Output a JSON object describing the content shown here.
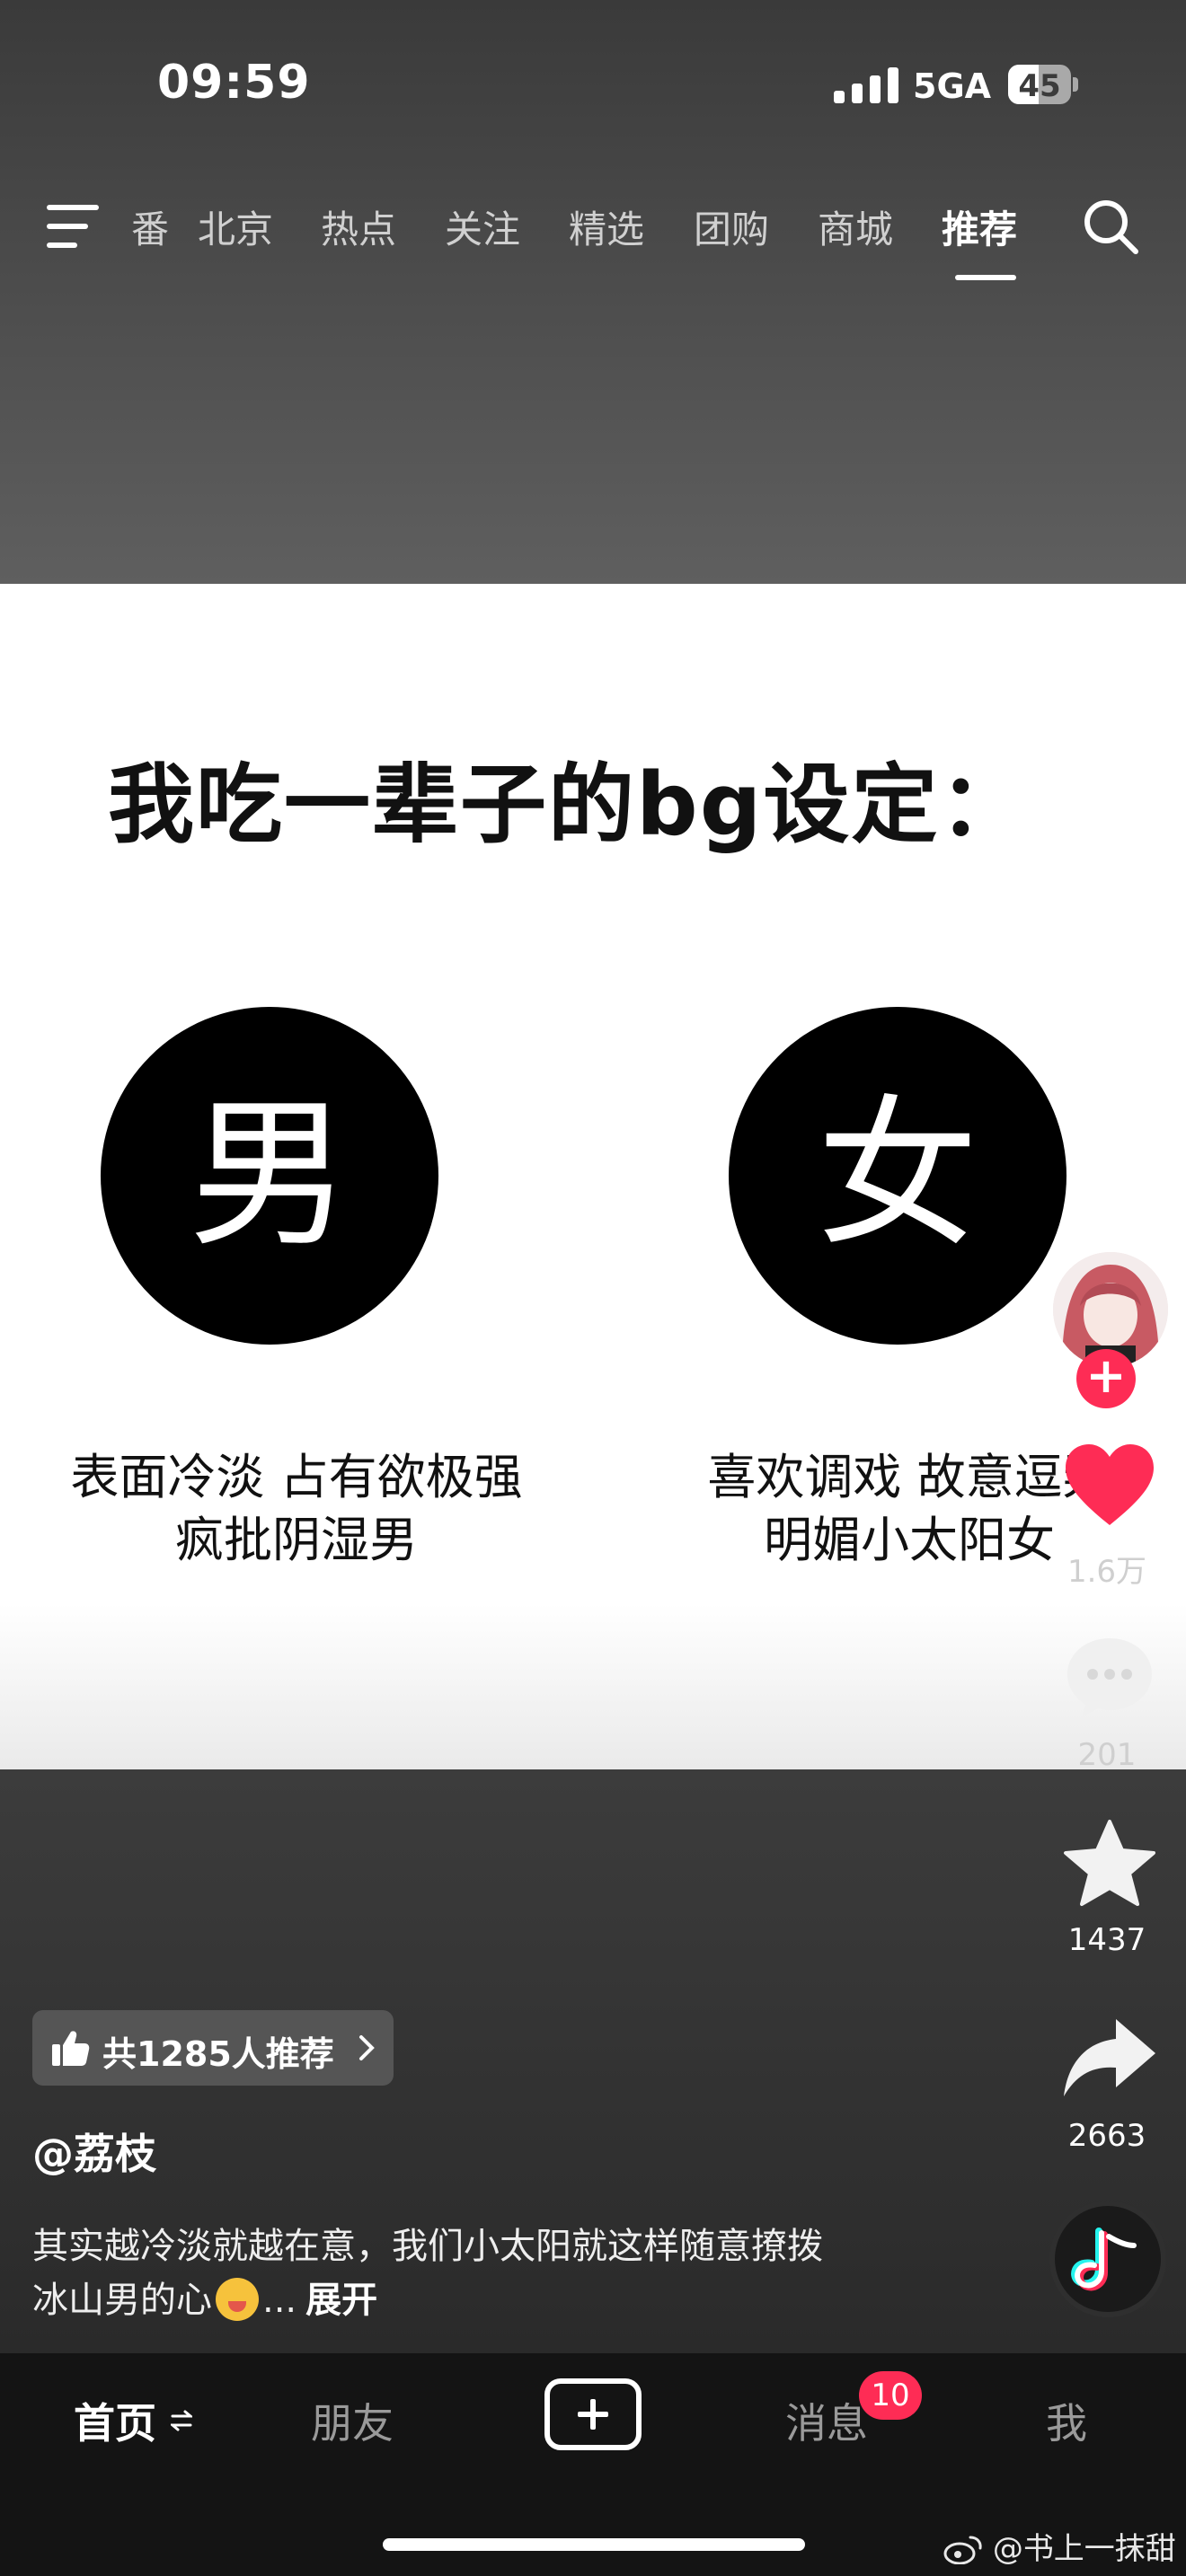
{
  "status_bar": {
    "time": "09:59",
    "network": "5GA",
    "battery_level": "45"
  },
  "top_nav": {
    "tabs": [
      {
        "label": "番"
      },
      {
        "label": "北京"
      },
      {
        "label": "热点"
      },
      {
        "label": "关注"
      },
      {
        "label": "精选"
      },
      {
        "label": "团购"
      },
      {
        "label": "商城"
      },
      {
        "label": "推荐"
      }
    ],
    "active_tab": "推荐"
  },
  "content": {
    "title": "我吃一辈子的bg设定：",
    "male": {
      "symbol": "男",
      "traits": [
        "表面冷淡 占有欲极强",
        "疯批阴湿男"
      ]
    },
    "female": {
      "symbol": "女",
      "traits": [
        "喜欢调戏 故意逗弄",
        "明媚小太阳女"
      ]
    }
  },
  "actions": {
    "follow_symbol": "+",
    "like_count": "1.6万",
    "comment_count": "201",
    "favorite_count": "1437",
    "share_count": "2663"
  },
  "video_info": {
    "recommend_text": "共1285人推荐",
    "author": "@荔枝",
    "caption_line1": "其实越冷淡就越在意，我们小太阳就这样随意撩拨",
    "caption_line2_text": "冰山男的心",
    "caption_ellipsis": "...",
    "expand_label": "展开"
  },
  "bottom_nav": {
    "home": "首页",
    "friends": "朋友",
    "messages": "消息",
    "message_badge": "10",
    "me": "我"
  },
  "watermark": "@书上一抹甜",
  "colors": {
    "accent": "#fe2c55",
    "background": "#3f3f3f"
  },
  "icons": [
    "signal-icon",
    "battery-icon",
    "menu-icon",
    "search-icon",
    "heart-icon",
    "comment-icon",
    "star-icon",
    "share-icon",
    "thumbs-up-icon",
    "chevron-right-icon",
    "switch-icon",
    "plus-icon",
    "emoji-icon",
    "weibo-icon"
  ]
}
